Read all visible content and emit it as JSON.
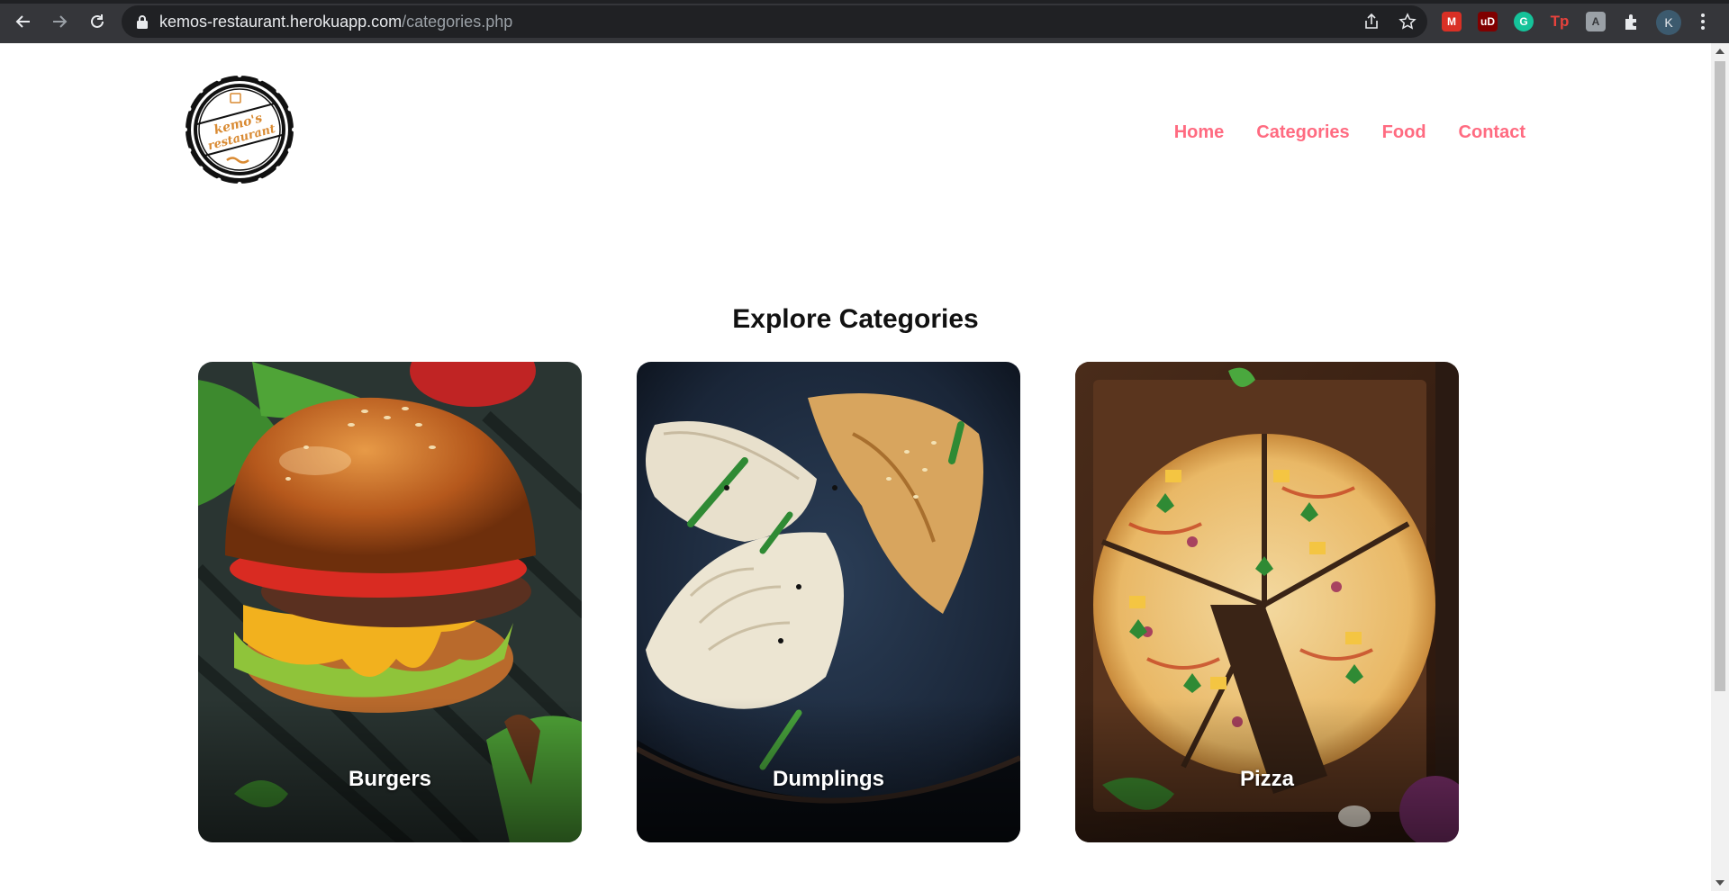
{
  "browser": {
    "url_host": "kemos-restaurant.herokuapp.com",
    "url_path": "/categories.php",
    "profile_initial": "K",
    "extensions": [
      {
        "name": "gmail-ext-icon",
        "letter": "M",
        "color": "#d93025"
      },
      {
        "name": "ublock-icon",
        "letter": "uD",
        "color": "#800000"
      },
      {
        "name": "grammarly-icon",
        "letter": "G",
        "color": "#15c39a"
      },
      {
        "name": "tp-ext-icon",
        "letter": "Tp",
        "color": "#e8423c"
      },
      {
        "name": "ext-generic-icon",
        "letter": "A",
        "color": "#9aa0a6"
      }
    ]
  },
  "header": {
    "logo_text_line1": "kemo's",
    "logo_text_line2": "restaurant",
    "nav": [
      "Home",
      "Categories",
      "Food",
      "Contact"
    ]
  },
  "main": {
    "title": "Explore Categories",
    "categories": [
      {
        "label": "Burgers",
        "image": "burger-photo"
      },
      {
        "label": "Dumplings",
        "image": "dumplings-photo"
      },
      {
        "label": "Pizza",
        "image": "pizza-photo"
      }
    ]
  },
  "colors": {
    "nav_link": "#ff6b81",
    "chrome_bg": "#35363a",
    "omnibox_bg": "#202124"
  }
}
